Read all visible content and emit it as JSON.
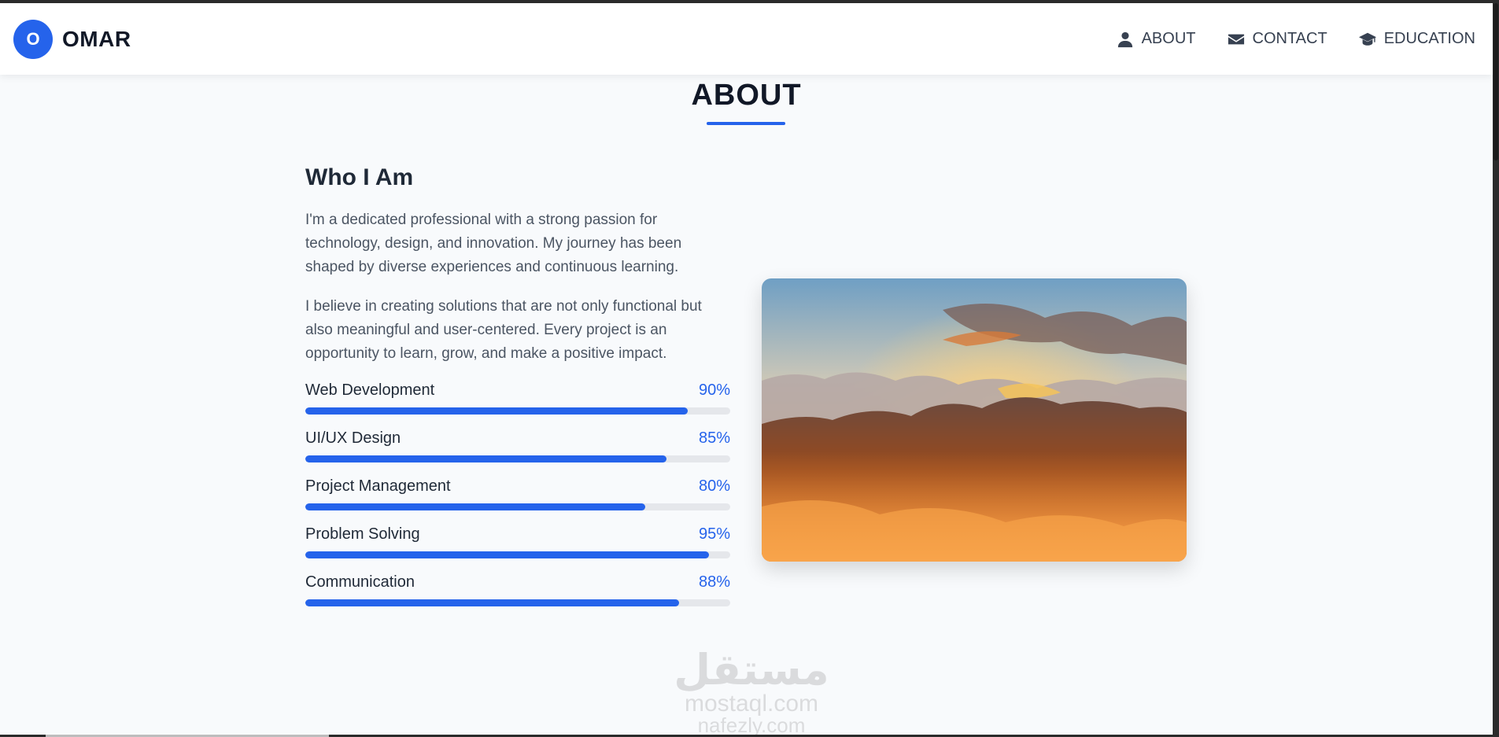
{
  "brand": {
    "initial": "O",
    "name": "OMAR"
  },
  "nav": {
    "items": [
      {
        "label": "ABOUT",
        "icon": "user-icon"
      },
      {
        "label": "CONTACT",
        "icon": "envelope-icon"
      },
      {
        "label": "EDUCATION",
        "icon": "graduation-cap-icon"
      }
    ]
  },
  "about": {
    "title": "ABOUT",
    "subheading": "Who I Am",
    "paragraphs": [
      "I'm a dedicated professional with a strong passion for technology, design, and innovation. My journey has been shaped by diverse experiences and continuous learning.",
      "I believe in creating solutions that are not only functional but also meaningful and user-centered. Every project is an opportunity to learn, grow, and make a positive impact."
    ],
    "skills": [
      {
        "name": "Web Development",
        "percent_label": "90%",
        "level": 0.9
      },
      {
        "name": "UI/UX Design",
        "percent_label": "85%",
        "level": 0.85
      },
      {
        "name": "Project Management",
        "percent_label": "80%",
        "level": 0.8
      },
      {
        "name": "Problem Solving",
        "percent_label": "95%",
        "level": 0.95
      },
      {
        "name": "Communication",
        "percent_label": "88%",
        "level": 0.88
      }
    ],
    "image_icon": "mountain-sunset-photo"
  },
  "watermark": {
    "line1": "مستقل",
    "line2": "mostaql.com",
    "line3": "nafezly.com"
  },
  "colors": {
    "accent": "#2563eb",
    "text": "#111827",
    "background": "#f8fafc"
  }
}
